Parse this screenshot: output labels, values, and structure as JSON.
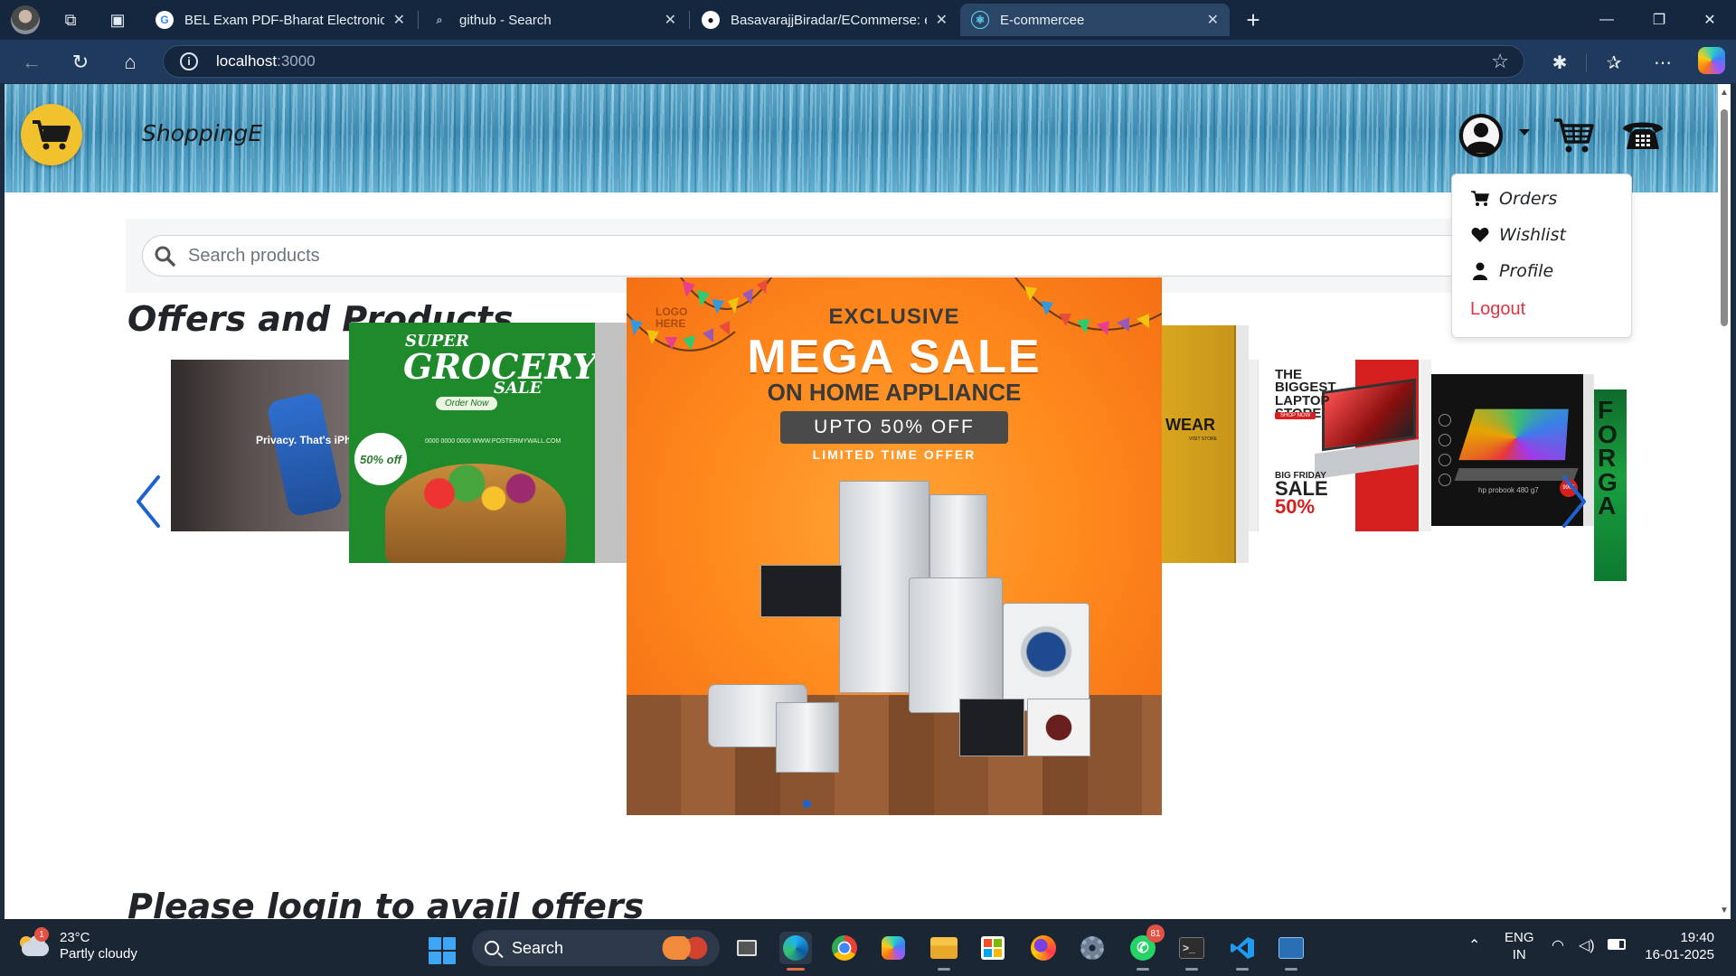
{
  "browser": {
    "tabs": [
      {
        "title": "BEL Exam PDF-Bharat Electronics",
        "favicon": "google-icon"
      },
      {
        "title": "github - Search",
        "favicon": "search-icon"
      },
      {
        "title": "BasavarajjBiradar/ECommerse: ec",
        "favicon": "github-icon"
      },
      {
        "title": "E-commercee",
        "favicon": "react-icon",
        "active": true
      }
    ],
    "url_host": "localhost",
    "url_port": ":3000"
  },
  "site": {
    "brand": "ShoppingE",
    "menu": {
      "orders": "Orders",
      "wishlist": "Wishlist",
      "profile": "Profile",
      "logout": "Logout"
    },
    "search_placeholder": "Search products",
    "section_title": "Offers and Products",
    "login_prompt": "Please login to avail offers",
    "colors": {
      "logout": "#dc3545",
      "carousel_arrow": "#1e62d0",
      "logo_bg": "#f2c12e"
    }
  },
  "carousel": {
    "iphone": {
      "caption": "Privacy. That's iPh"
    },
    "grocery": {
      "super": "SUPER",
      "grocery": "GROCERY",
      "sale": "SALE",
      "order": "Order Now",
      "web": "0000 0000 0000  WWW.POSTERMYWALL.COM",
      "badge": "50% off"
    },
    "main": {
      "logo_here": "LOGO HERE",
      "exclusive": "EXCLUSIVE",
      "mega": "MEGA SALE",
      "home": "ON HOME APPLIANCE",
      "upto": "UPTO 50% OFF",
      "limited": "LIMITED TIME OFFER"
    },
    "wear": {
      "title": "WEAR",
      "sub": "VISIT STORE"
    },
    "laptop_store": {
      "title": "THE BIGGEST LAPTOP STORE",
      "shop": "SHOP NOW",
      "black_friday": "BIG FRIDAY",
      "sale": "SALE",
      "percent": "50%"
    },
    "hp": {
      "model": "hp probook 480 g7",
      "price": "9905"
    },
    "green": {
      "text": "FOR GA"
    }
  },
  "taskbar": {
    "temp": "23°C",
    "weather": "Partly cloudy",
    "weather_badge": "1",
    "search": "Search",
    "whatsapp_badge": "81",
    "lang1": "ENG",
    "lang2": "IN",
    "time": "19:40",
    "date": "16-01-2025"
  }
}
